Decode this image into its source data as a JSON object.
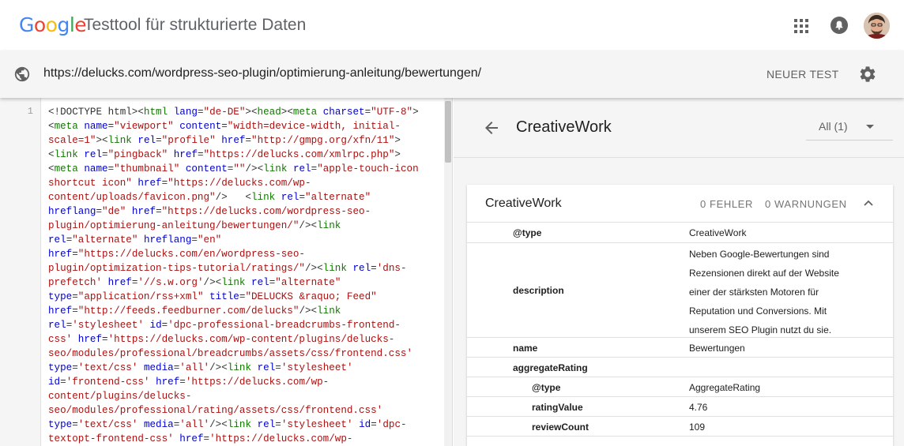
{
  "header": {
    "logo": {
      "letters": [
        {
          "ch": "G",
          "color": "#4285F4"
        },
        {
          "ch": "o",
          "color": "#EA4335"
        },
        {
          "ch": "o",
          "color": "#FBBC05"
        },
        {
          "ch": "g",
          "color": "#4285F4"
        },
        {
          "ch": "l",
          "color": "#34A853"
        },
        {
          "ch": "e",
          "color": "#EA4335"
        }
      ]
    },
    "title": "Testtool für strukturierte Daten",
    "icons": [
      "apps-icon",
      "notifications-icon",
      "avatar"
    ]
  },
  "urlbar": {
    "url": "https://delucks.com/wordpress-seo-plugin/optimierung-anleitung/bewertungen/",
    "new_test_label": "NEUER TEST",
    "icons": [
      "globe-icon",
      "gear-icon"
    ]
  },
  "code": {
    "line_number": "1",
    "lines": [
      [
        [
          "p",
          "<!DOCTYPE html><"
        ],
        [
          "t",
          "html"
        ],
        [
          "p",
          " "
        ],
        [
          "a",
          "lang"
        ],
        [
          "p",
          "="
        ],
        [
          "v",
          "\"de-DE\""
        ],
        [
          "p",
          "><"
        ],
        [
          "t",
          "head"
        ],
        [
          "p",
          "><"
        ],
        [
          "t",
          "meta"
        ],
        [
          "p",
          " "
        ],
        [
          "a",
          "charset"
        ],
        [
          "p",
          "="
        ],
        [
          "v",
          "\"UTF-8\""
        ],
        [
          "p",
          ">"
        ]
      ],
      [
        [
          "p",
          "<"
        ],
        [
          "t",
          "meta"
        ],
        [
          "p",
          " "
        ],
        [
          "a",
          "name"
        ],
        [
          "p",
          "="
        ],
        [
          "v",
          "\"viewport\""
        ],
        [
          "p",
          " "
        ],
        [
          "a",
          "content"
        ],
        [
          "p",
          "="
        ],
        [
          "v",
          "\"width=device-width, initial-"
        ]
      ],
      [
        [
          "v",
          "scale=1\""
        ],
        [
          "p",
          "><"
        ],
        [
          "t",
          "link"
        ],
        [
          "p",
          " "
        ],
        [
          "a",
          "rel"
        ],
        [
          "p",
          "="
        ],
        [
          "v",
          "\"profile\""
        ],
        [
          "p",
          " "
        ],
        [
          "a",
          "href"
        ],
        [
          "p",
          "="
        ],
        [
          "v",
          "\"http://gmpg.org/xfn/11\""
        ],
        [
          "p",
          ">"
        ]
      ],
      [
        [
          "p",
          "<"
        ],
        [
          "t",
          "link"
        ],
        [
          "p",
          " "
        ],
        [
          "a",
          "rel"
        ],
        [
          "p",
          "="
        ],
        [
          "v",
          "\"pingback\""
        ],
        [
          "p",
          " "
        ],
        [
          "a",
          "href"
        ],
        [
          "p",
          "="
        ],
        [
          "v",
          "\"https://delucks.com/xmlrpc.php\""
        ],
        [
          "p",
          ">"
        ]
      ],
      [
        [
          "p",
          "<"
        ],
        [
          "t",
          "meta"
        ],
        [
          "p",
          " "
        ],
        [
          "a",
          "name"
        ],
        [
          "p",
          "="
        ],
        [
          "v",
          "\"thumbnail\""
        ],
        [
          "p",
          " "
        ],
        [
          "a",
          "content"
        ],
        [
          "p",
          "="
        ],
        [
          "v",
          "\"\""
        ],
        [
          "p",
          "/><"
        ],
        [
          "t",
          "link"
        ],
        [
          "p",
          " "
        ],
        [
          "a",
          "rel"
        ],
        [
          "p",
          "="
        ],
        [
          "v",
          "\"apple-touch-icon"
        ]
      ],
      [
        [
          "v",
          "shortcut icon\""
        ],
        [
          "p",
          " "
        ],
        [
          "a",
          "href"
        ],
        [
          "p",
          "="
        ],
        [
          "v",
          "\"https://delucks.com/wp-"
        ]
      ],
      [
        [
          "v",
          "content/uploads/favicon.png\""
        ],
        [
          "p",
          "/>   <"
        ],
        [
          "t",
          "link"
        ],
        [
          "p",
          " "
        ],
        [
          "a",
          "rel"
        ],
        [
          "p",
          "="
        ],
        [
          "v",
          "\"alternate\""
        ]
      ],
      [
        [
          "a",
          "hreflang"
        ],
        [
          "p",
          "="
        ],
        [
          "v",
          "\"de\""
        ],
        [
          "p",
          " "
        ],
        [
          "a",
          "href"
        ],
        [
          "p",
          "="
        ],
        [
          "v",
          "\"https://delucks.com/wordpress-seo-"
        ]
      ],
      [
        [
          "v",
          "plugin/optimierung-anleitung/bewertungen/\""
        ],
        [
          "p",
          "/><"
        ],
        [
          "t",
          "link"
        ]
      ],
      [
        [
          "a",
          "rel"
        ],
        [
          "p",
          "="
        ],
        [
          "v",
          "\"alternate\""
        ],
        [
          "p",
          " "
        ],
        [
          "a",
          "hreflang"
        ],
        [
          "p",
          "="
        ],
        [
          "v",
          "\"en\""
        ]
      ],
      [
        [
          "a",
          "href"
        ],
        [
          "p",
          "="
        ],
        [
          "v",
          "\"https://delucks.com/en/wordpress-seo-"
        ]
      ],
      [
        [
          "v",
          "plugin/optimization-tips-tutorial/ratings/\""
        ],
        [
          "p",
          "/><"
        ],
        [
          "t",
          "link"
        ],
        [
          "p",
          " "
        ],
        [
          "a",
          "rel"
        ],
        [
          "p",
          "="
        ],
        [
          "v",
          "'dns-"
        ]
      ],
      [
        [
          "v",
          "prefetch'"
        ],
        [
          "p",
          " "
        ],
        [
          "a",
          "href"
        ],
        [
          "p",
          "="
        ],
        [
          "v",
          "'//s.w.org'"
        ],
        [
          "p",
          "/><"
        ],
        [
          "t",
          "link"
        ],
        [
          "p",
          " "
        ],
        [
          "a",
          "rel"
        ],
        [
          "p",
          "="
        ],
        [
          "v",
          "\"alternate\""
        ]
      ],
      [
        [
          "a",
          "type"
        ],
        [
          "p",
          "="
        ],
        [
          "v",
          "\"application/rss+xml\""
        ],
        [
          "p",
          " "
        ],
        [
          "a",
          "title"
        ],
        [
          "p",
          "="
        ],
        [
          "v",
          "\"DELUCKS &raquo; Feed\""
        ]
      ],
      [
        [
          "a",
          "href"
        ],
        [
          "p",
          "="
        ],
        [
          "v",
          "\"http://feeds.feedburner.com/delucks\""
        ],
        [
          "p",
          "/><"
        ],
        [
          "t",
          "link"
        ]
      ],
      [
        [
          "a",
          "rel"
        ],
        [
          "p",
          "="
        ],
        [
          "v",
          "'stylesheet'"
        ],
        [
          "p",
          " "
        ],
        [
          "a",
          "id"
        ],
        [
          "p",
          "="
        ],
        [
          "v",
          "'dpc-professional-breadcrumbs-frontend-"
        ]
      ],
      [
        [
          "v",
          "css'"
        ],
        [
          "p",
          " "
        ],
        [
          "a",
          "href"
        ],
        [
          "p",
          "="
        ],
        [
          "v",
          "'https://delucks.com/wp-content/plugins/delucks-"
        ]
      ],
      [
        [
          "v",
          "seo/modules/professional/breadcrumbs/assets/css/frontend.css'"
        ]
      ],
      [
        [
          "a",
          "type"
        ],
        [
          "p",
          "="
        ],
        [
          "v",
          "'text/css'"
        ],
        [
          "p",
          " "
        ],
        [
          "a",
          "media"
        ],
        [
          "p",
          "="
        ],
        [
          "v",
          "'all'"
        ],
        [
          "p",
          "/><"
        ],
        [
          "t",
          "link"
        ],
        [
          "p",
          " "
        ],
        [
          "a",
          "rel"
        ],
        [
          "p",
          "="
        ],
        [
          "v",
          "'stylesheet'"
        ]
      ],
      [
        [
          "a",
          "id"
        ],
        [
          "p",
          "="
        ],
        [
          "v",
          "'frontend-css'"
        ],
        [
          "p",
          " "
        ],
        [
          "a",
          "href"
        ],
        [
          "p",
          "="
        ],
        [
          "v",
          "'https://delucks.com/wp-"
        ]
      ],
      [
        [
          "v",
          "content/plugins/delucks-"
        ]
      ],
      [
        [
          "v",
          "seo/modules/professional/rating/assets/css/frontend.css'"
        ]
      ],
      [
        [
          "a",
          "type"
        ],
        [
          "p",
          "="
        ],
        [
          "v",
          "'text/css'"
        ],
        [
          "p",
          " "
        ],
        [
          "a",
          "media"
        ],
        [
          "p",
          "="
        ],
        [
          "v",
          "'all'"
        ],
        [
          "p",
          "/><"
        ],
        [
          "t",
          "link"
        ],
        [
          "p",
          " "
        ],
        [
          "a",
          "rel"
        ],
        [
          "p",
          "="
        ],
        [
          "v",
          "'stylesheet'"
        ],
        [
          "p",
          " "
        ],
        [
          "a",
          "id"
        ],
        [
          "p",
          "="
        ],
        [
          "v",
          "'dpc-"
        ]
      ],
      [
        [
          "v",
          "textopt-frontend-css'"
        ],
        [
          "p",
          " "
        ],
        [
          "a",
          "href"
        ],
        [
          "p",
          "="
        ],
        [
          "v",
          "'https://delucks.com/wp-"
        ]
      ]
    ]
  },
  "results": {
    "title": "CreativeWork",
    "filter_label": "All (1)",
    "card": {
      "title": "CreativeWork",
      "errors": "0 FEHLER",
      "warnings": "0 WARNUNGEN",
      "rows": [
        {
          "key": "@type",
          "value": "CreativeWork"
        },
        {
          "key": "description",
          "value": "Neben Google-Bewertungen sind Rezensionen direkt auf der Website einer der stärksten Motoren für Reputation und Conversions. Mit unserem SEO Plugin nutzt du sie."
        },
        {
          "key": "name",
          "value": "Bewertungen"
        },
        {
          "key": "aggregateRating",
          "value": ""
        },
        {
          "key": "@type",
          "value": "AggregateRating"
        },
        {
          "key": "ratingValue",
          "value": "4.76"
        },
        {
          "key": "reviewCount",
          "value": "109"
        }
      ]
    }
  }
}
